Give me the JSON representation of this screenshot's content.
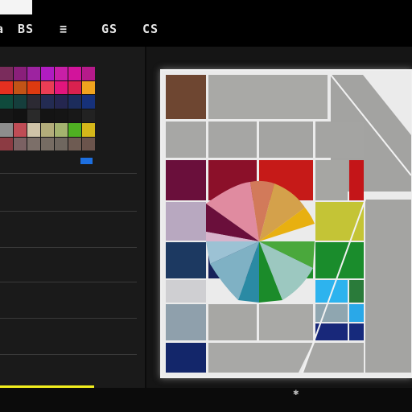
{
  "toolbar": {
    "buttons": [
      {
        "name": "a-button",
        "label": "a"
      },
      {
        "name": "bs-button",
        "label": "BS"
      },
      {
        "name": "equal-button",
        "label": "≡"
      },
      {
        "name": "gs-button",
        "label": "GS"
      },
      {
        "name": "cs-button",
        "label": "CS"
      }
    ]
  },
  "left_panel": {
    "header_left": "",
    "header_right": "",
    "swatches": [
      "#7a2c5c",
      "#8a1f7a",
      "#9d23a0",
      "#b01cc2",
      "#c81fa7",
      "#d2149b",
      "#b61a8a",
      "#e53020",
      "#c25316",
      "#dd3a10",
      "#ea3d55",
      "#e2157d",
      "#d9214f",
      "#f0a31e",
      "#0f4a3c",
      "#153e3c",
      "#2c2a33",
      "#232b52",
      "#24264f",
      "#1c2c5b",
      "#16317a",
      "#161616",
      "#121212",
      "#2a2a2a",
      "#141414",
      "#151515",
      "#181818",
      "#222222",
      "#8d8d8d",
      "#bf4c55",
      "#cfc3a8",
      "#b3ad7b",
      "#a4b36f",
      "#4fb022",
      "#d5b71a",
      "#8c3b43",
      "#7b6163",
      "#7c6f69",
      "#766c63",
      "#6f675f",
      "#6e5b52",
      "#6b544c"
    ],
    "paragraphs": [
      "",
      "",
      "",
      "",
      ""
    ],
    "yellow_button_label": ""
  },
  "right_panel": {
    "header": "",
    "canvas_label": "",
    "canvas_marker": ""
  },
  "status": {
    "icon": "bug-icon"
  }
}
